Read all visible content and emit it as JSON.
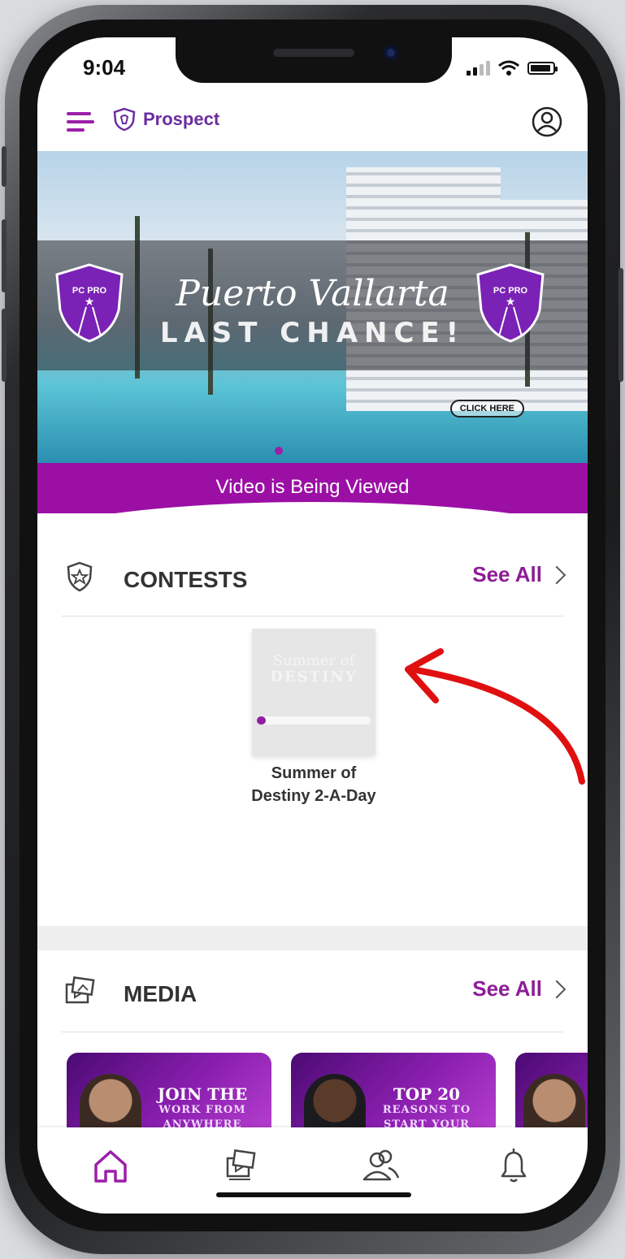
{
  "status_bar": {
    "time": "9:04"
  },
  "header": {
    "brand": "Prospect",
    "icons": [
      "menu-icon",
      "shield-logo-icon",
      "profile-icon"
    ]
  },
  "banner": {
    "script_title": "Puerto Vallarta",
    "subtitle": "LAST CHANCE!",
    "badge_label": "PC PRO",
    "cta": "CLICK HERE"
  },
  "video_status": "Video is Being Viewed",
  "contests": {
    "title": "CONTESTS",
    "see_all": "See All",
    "item": {
      "card_title_line1": "Summer of",
      "card_title_line2": "DESTINY",
      "name_line1": "Summer of",
      "name_line2": "Destiny 2-A-Day",
      "progress": 0.08
    }
  },
  "media": {
    "title": "MEDIA",
    "see_all": "See All",
    "cards": [
      {
        "big": "JOIN THE",
        "small1": "WORK FROM",
        "small2": "ANYWHERE"
      },
      {
        "big": "TOP 20",
        "small1": "REASONS TO",
        "small2": "START YOUR"
      }
    ]
  },
  "tabbar": {
    "tabs": [
      "home-icon",
      "media-icon",
      "people-icon",
      "bell-icon"
    ]
  },
  "colors": {
    "accent": "#9b0fa5",
    "brand": "#6b2da0",
    "arrow": "#e01010"
  }
}
